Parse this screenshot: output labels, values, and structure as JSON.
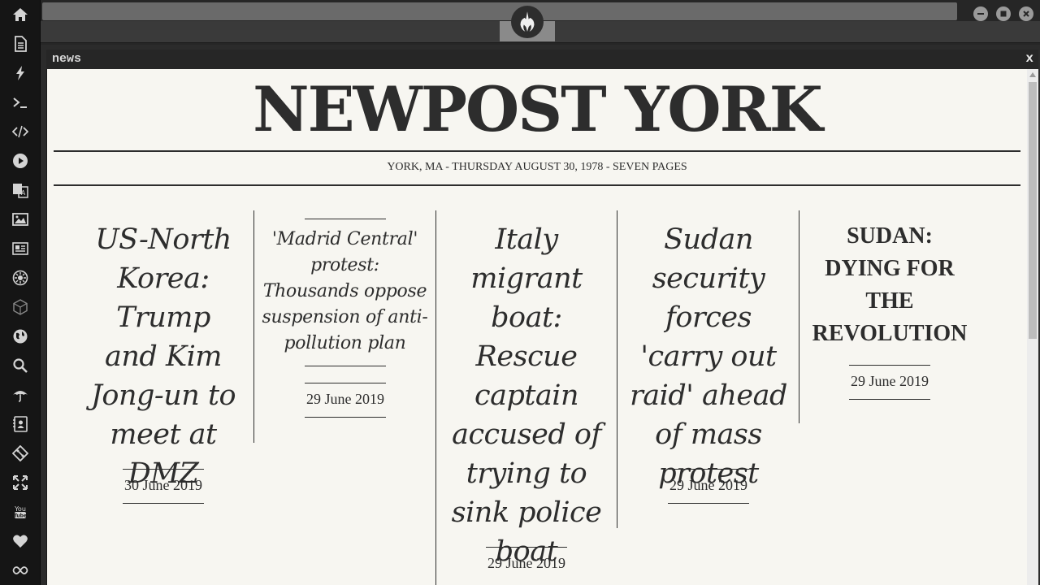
{
  "window": {
    "title": "news",
    "close_label": "x"
  },
  "dock": {
    "icons": [
      "home-icon",
      "document-icon",
      "lightning-icon",
      "terminal-icon",
      "code-icon",
      "play-icon",
      "translate-icon",
      "image-icon",
      "newspaper-icon",
      "settings-icon",
      "cube-icon",
      "globe-icon",
      "search-icon",
      "umbrella-icon",
      "contacts-icon",
      "git-icon",
      "fullscreen-icon",
      "youtube-icon",
      "heart-icon",
      "infinity-icon"
    ]
  },
  "newspaper": {
    "masthead": "NEWPOST YORK",
    "dateline": "YORK, MA - THURSDAY AUGUST 30, 1978 - SEVEN PAGES",
    "articles": [
      {
        "headline": "US-North Korea: Trump and Kim Jong-un to meet at DMZ",
        "date": "30 June 2019"
      },
      {
        "headline": "'Madrid Central' protest: Thousands oppose suspension of anti-pollution plan",
        "date": "29 June 2019"
      },
      {
        "headline": "Italy migrant boat: Rescue captain accused of trying to sink police boat",
        "date": "29 June 2019"
      },
      {
        "headline": "Sudan security forces 'carry out raid' ahead of mass protest",
        "date": "29 June 2019"
      },
      {
        "headline": "SUDAN: DYING FOR THE REVOLUTION",
        "date": "29 June 2019"
      }
    ]
  }
}
